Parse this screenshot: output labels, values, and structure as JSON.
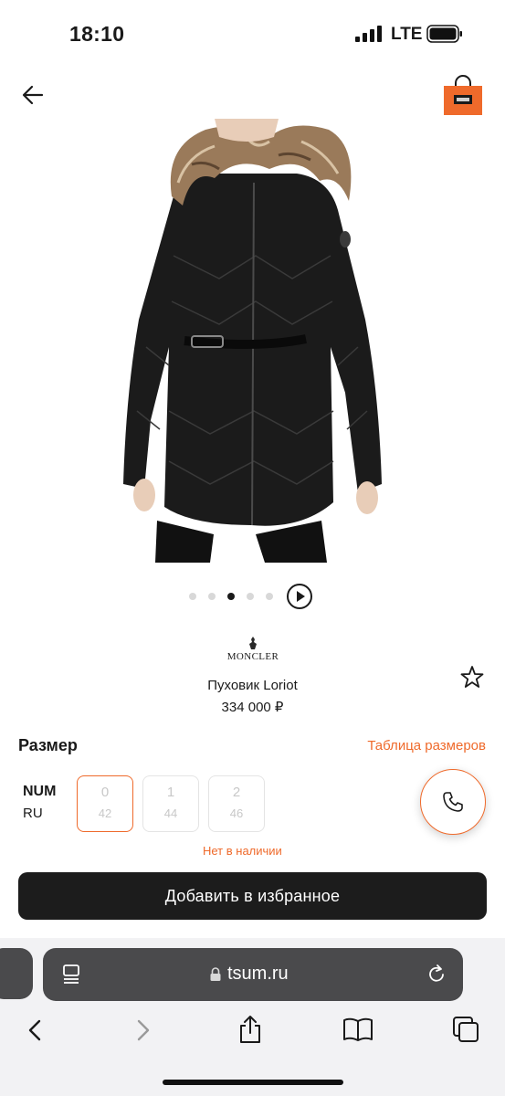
{
  "status_bar": {
    "time": "18:10",
    "network": "LTE"
  },
  "header": {
    "back_icon": "arrow-left-icon",
    "cart_icon": "shopping-bag-icon",
    "cart_color": "#ef6a2b"
  },
  "carousel": {
    "total": 5,
    "active_index": 2,
    "play_icon": "play-circle-icon"
  },
  "product": {
    "brand": "MONCLER",
    "name": "Пуховик Loriot",
    "price": "334 000 ₽",
    "favorite_icon": "star-outline-icon"
  },
  "size_section": {
    "title": "Размер",
    "table_link": "Таблица размеров",
    "system_num": "NUM",
    "system_ru": "RU",
    "sizes": [
      {
        "num": "0",
        "ru": "42",
        "selected": true
      },
      {
        "num": "1",
        "ru": "44",
        "selected": false
      },
      {
        "num": "2",
        "ru": "46",
        "selected": false
      }
    ],
    "status": "Нет в наличии",
    "call_icon": "phone-icon"
  },
  "actions": {
    "add_to_favorites": "Добавить в избранное"
  },
  "browser": {
    "url": "tsum.ru",
    "icons": [
      "tabs-icon",
      "lock-icon",
      "reload-icon",
      "back-icon",
      "forward-icon",
      "share-icon",
      "bookmarks-icon",
      "tabs-overview-icon"
    ]
  },
  "colors": {
    "accent": "#ef6a2b",
    "dark": "#1c1c1c",
    "chrome": "#4a4a4c"
  }
}
